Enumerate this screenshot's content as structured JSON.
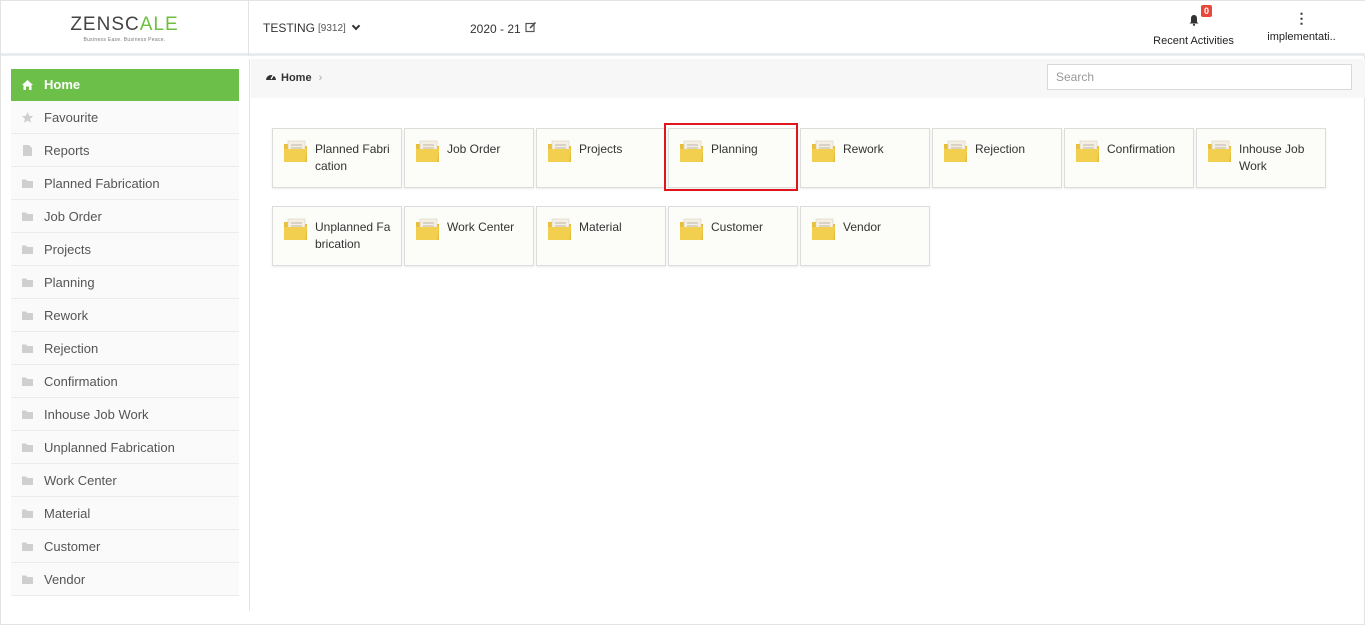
{
  "header": {
    "logo_main": "ZENSC",
    "logo_accent": "ALE",
    "logo_tagline": "Business Ease. Business Peace.",
    "company_name": "TESTING",
    "company_code": "[9312]",
    "fiscal_year": "2020 - 21",
    "notifications_count": "0",
    "notifications_label": "Recent Activities",
    "user_label": "implementati.."
  },
  "sidebar": {
    "items": [
      {
        "label": "Home",
        "icon": "home-icon",
        "active": true
      },
      {
        "label": "Favourite",
        "icon": "star-icon"
      },
      {
        "label": "Reports",
        "icon": "file-icon"
      },
      {
        "label": "Planned Fabrication",
        "icon": "folder-icon"
      },
      {
        "label": "Job Order",
        "icon": "folder-icon"
      },
      {
        "label": "Projects",
        "icon": "folder-icon"
      },
      {
        "label": "Planning",
        "icon": "folder-icon"
      },
      {
        "label": "Rework",
        "icon": "folder-icon"
      },
      {
        "label": "Rejection",
        "icon": "folder-icon"
      },
      {
        "label": "Confirmation",
        "icon": "folder-icon"
      },
      {
        "label": "Inhouse Job Work",
        "icon": "folder-icon"
      },
      {
        "label": "Unplanned Fabrication",
        "icon": "folder-icon"
      },
      {
        "label": "Work Center",
        "icon": "folder-icon"
      },
      {
        "label": "Material",
        "icon": "folder-icon"
      },
      {
        "label": "Customer",
        "icon": "folder-icon"
      },
      {
        "label": "Vendor",
        "icon": "folder-icon"
      }
    ]
  },
  "breadcrumb": {
    "home_label": "Home"
  },
  "search": {
    "placeholder": "Search"
  },
  "tiles": [
    {
      "label": "Planned Fabrication"
    },
    {
      "label": "Job Order"
    },
    {
      "label": "Projects"
    },
    {
      "label": "Planning"
    },
    {
      "label": "Rework"
    },
    {
      "label": "Rejection"
    },
    {
      "label": "Confirmation"
    },
    {
      "label": "Inhouse Job Work"
    },
    {
      "label": "Unplanned Fabrication"
    },
    {
      "label": "Work Center"
    },
    {
      "label": "Material"
    },
    {
      "label": "Customer"
    },
    {
      "label": "Vendor"
    }
  ],
  "colors": {
    "accent": "#6cc04a",
    "highlight": "#e0151b",
    "badge": "#e8483a",
    "folder": "#f2cf4f"
  }
}
